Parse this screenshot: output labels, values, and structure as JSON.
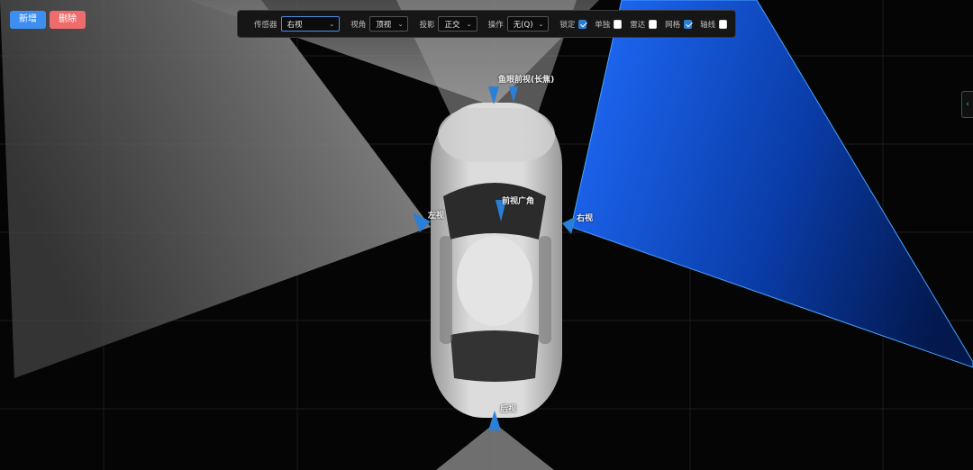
{
  "buttons": {
    "add": "新增",
    "delete": "删除"
  },
  "toolbar": {
    "sensor_label": "传感器",
    "sensor_value": "右视",
    "view_label": "视角",
    "view_value": "顶视",
    "projection_label": "投影",
    "projection_value": "正交",
    "operation_label": "操作",
    "operation_value": "无(Q)",
    "lock_label": "锁定",
    "lock_checked": true,
    "solo_label": "单独",
    "solo_checked": false,
    "radar_label": "雷达",
    "radar_checked": false,
    "grid_label": "网格",
    "grid_checked": true,
    "axis_label": "轴线",
    "axis_checked": false
  },
  "cameras": {
    "front_fisheye": "鱼眼前视(长焦)",
    "front_wide": "前视广角",
    "left": "左视",
    "right": "右视",
    "rear": "后视"
  },
  "colors": {
    "accent": "#1e6ff0",
    "frustum": "#8c8c8c",
    "add": "#3d8ef0",
    "delete": "#f06b6b"
  }
}
